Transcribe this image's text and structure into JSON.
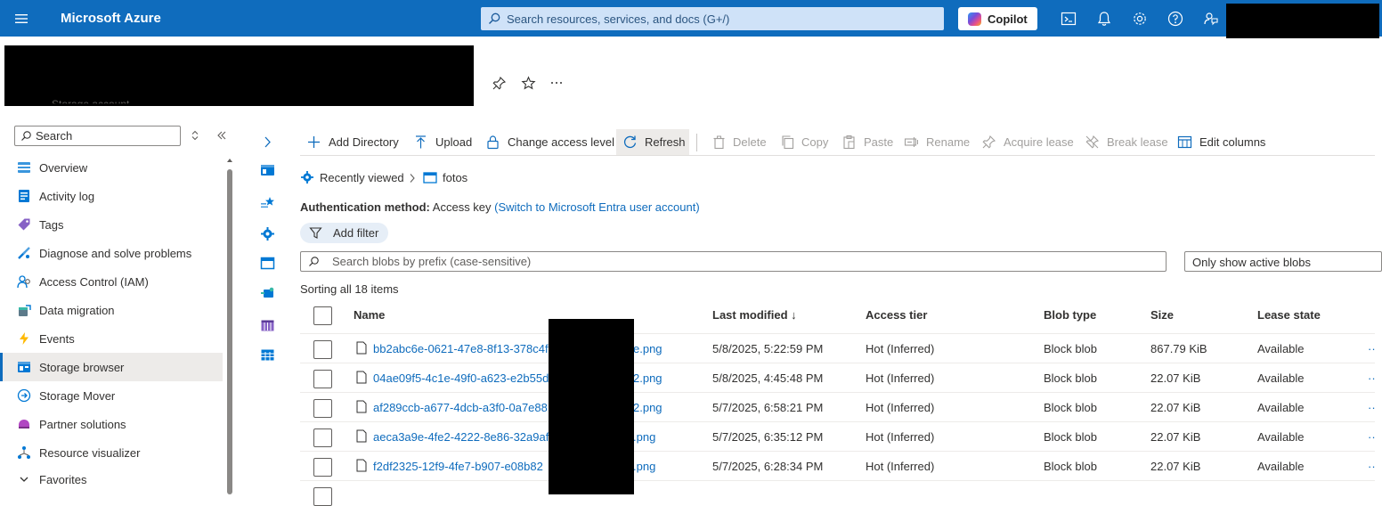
{
  "topbar": {
    "brand": "Microsoft Azure",
    "search_placeholder": "Search resources, services, and docs (G+/)",
    "copilot_label": "Copilot",
    "icons": [
      "menu-icon",
      "search-icon",
      "cloud-shell-icon",
      "notifications-icon",
      "settings-icon",
      "help-icon",
      "feedback-icon"
    ]
  },
  "resource": {
    "subtitle_partial": "Storage account"
  },
  "nav": {
    "search_placeholder": "Search",
    "items": [
      {
        "label": "Overview",
        "icon": "overview-icon"
      },
      {
        "label": "Activity log",
        "icon": "activity-log-icon"
      },
      {
        "label": "Tags",
        "icon": "tag-icon"
      },
      {
        "label": "Diagnose and solve problems",
        "icon": "diagnose-icon"
      },
      {
        "label": "Access Control (IAM)",
        "icon": "iam-icon"
      },
      {
        "label": "Data migration",
        "icon": "data-migration-icon"
      },
      {
        "label": "Events",
        "icon": "events-icon"
      },
      {
        "label": "Storage browser",
        "icon": "storage-browser-icon",
        "active": true
      },
      {
        "label": "Storage Mover",
        "icon": "storage-mover-icon"
      },
      {
        "label": "Partner solutions",
        "icon": "partner-icon"
      },
      {
        "label": "Resource visualizer",
        "icon": "visualizer-icon"
      },
      {
        "label": "Favorites",
        "icon": "chevron-down-icon"
      }
    ]
  },
  "toolbar": {
    "add_directory": "Add Directory",
    "upload": "Upload",
    "change_access_level": "Change access level",
    "refresh": "Refresh",
    "delete": "Delete",
    "copy": "Copy",
    "paste": "Paste",
    "rename": "Rename",
    "acquire_lease": "Acquire lease",
    "break_lease": "Break lease",
    "edit_columns": "Edit columns"
  },
  "breadcrumb": {
    "recent": "Recently viewed",
    "container": "fotos"
  },
  "auth": {
    "label": "Authentication method:",
    "value": "Access key",
    "link": "(Switch to Microsoft Entra user account)"
  },
  "filter": {
    "add_filter": "Add filter",
    "search_placeholder": "Search blobs by prefix (case-sensitive)",
    "active_select": "Only show active blobs"
  },
  "sort_info": "Sorting all 18 items",
  "table": {
    "headers": {
      "name": "Name",
      "last_modified": "Last modified ↓",
      "access_tier": "Access tier",
      "blob_type": "Blob type",
      "size": "Size",
      "lease_state": "Lease state"
    },
    "rows": [
      {
        "name_start": "bb2abc6e-0621-47e8-8f13-378c4f",
        "name_end": "e.png",
        "modified": "5/8/2025, 5:22:59 PM",
        "tier": "Hot (Inferred)",
        "type": "Block blob",
        "size": "867.79 KiB",
        "lease": "Available"
      },
      {
        "name_start": "04ae09f5-4c1e-49f0-a623-e2b55d",
        "name_end": "2.png",
        "modified": "5/8/2025, 4:45:48 PM",
        "tier": "Hot (Inferred)",
        "type": "Block blob",
        "size": "22.07 KiB",
        "lease": "Available"
      },
      {
        "name_start": "af289ccb-a677-4dcb-a3f0-0a7e88",
        "name_end": "2.png",
        "modified": "5/7/2025, 6:58:21 PM",
        "tier": "Hot (Inferred)",
        "type": "Block blob",
        "size": "22.07 KiB",
        "lease": "Available"
      },
      {
        "name_start": "aeca3a9e-4fe2-4222-8e86-32a9af",
        "name_end": ".png",
        "modified": "5/7/2025, 6:35:12 PM",
        "tier": "Hot (Inferred)",
        "type": "Block blob",
        "size": "22.07 KiB",
        "lease": "Available"
      },
      {
        "name_start": "f2df2325-12f9-4fe7-b907-e08b82",
        "name_end": ".png",
        "modified": "5/7/2025, 6:28:34 PM",
        "tier": "Hot (Inferred)",
        "type": "Block blob",
        "size": "22.07 KiB",
        "lease": "Available"
      }
    ],
    "more_glyph": "··"
  },
  "colors": {
    "accent": "#0f6cbd",
    "topbar": "#0f6cbd",
    "search_bg": "#cfe2f8",
    "active_nav": "#edebe9",
    "disabled_text": "#a19f9d"
  }
}
